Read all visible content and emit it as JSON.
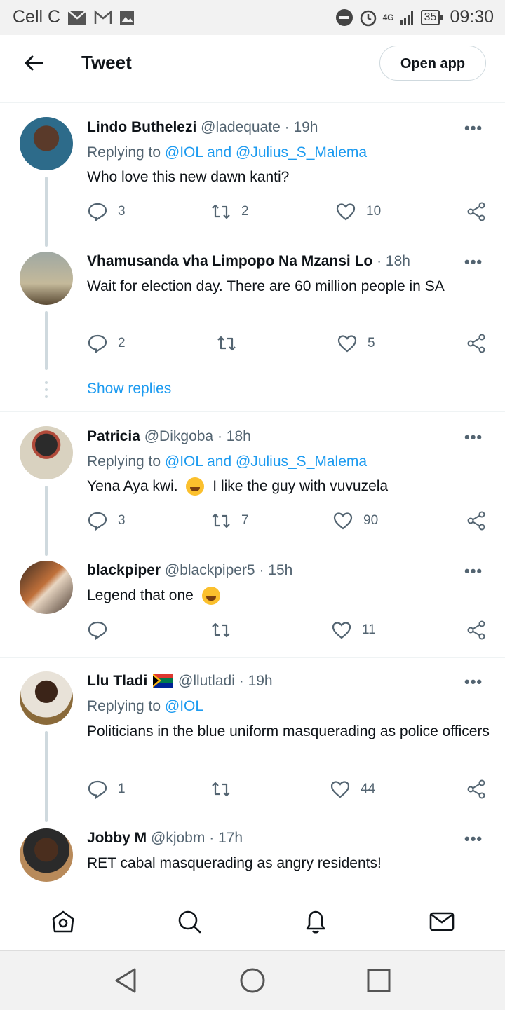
{
  "status_bar": {
    "carrier": "Cell C",
    "network": "4G",
    "battery": "35",
    "time": "09:30"
  },
  "header": {
    "title": "Tweet",
    "open_app_label": "Open app"
  },
  "tweets": [
    {
      "name": "Lindo Buthelezi",
      "handle": "@ladequate",
      "time": "19h",
      "replying_prefix": "Replying to",
      "replying_to": "@IOL and @Julius_S_Malema",
      "text": "Who love this new dawn kanti?",
      "replies": "3",
      "retweets": "2",
      "likes": "10"
    },
    {
      "name": "Vhamusanda vha Limpopo Na Mzansi Lo",
      "handle": "",
      "time": "18h",
      "text": "Wait for election day. There are 60 million people in SA",
      "replies": "2",
      "retweets": "",
      "likes": "5"
    },
    {
      "name": "Patricia",
      "handle": "@Dikgoba",
      "time": "18h",
      "replying_prefix": "Replying to",
      "replying_to": "@IOL and @Julius_S_Malema",
      "text_before_emoji": "Yena Aya kwi.",
      "text_after_emoji": "I like the guy with vuvuzela",
      "replies": "3",
      "retweets": "7",
      "likes": "90"
    },
    {
      "name": "blackpiper",
      "handle": "@blackpiper5",
      "time": "15h",
      "text": "Legend that one",
      "replies": "",
      "retweets": "",
      "likes": "11"
    },
    {
      "name": "Llu Tladi",
      "handle": "@llutladi",
      "time": "19h",
      "replying_prefix": "Replying to",
      "replying_to": "@IOL",
      "text": "Politicians in the blue uniform masquerading as police officers",
      "replies": "1",
      "retweets": "",
      "likes": "44"
    },
    {
      "name": "Jobby M",
      "handle": "@kjobm",
      "time": "17h",
      "text": "RET cabal masquerading as angry residents!"
    }
  ],
  "show_replies_label": "Show replies",
  "more_label": "•••",
  "separator": "·",
  "colors": {
    "link": "#1d9bf0",
    "secondary": "#536471",
    "primary_text": "#0f1419"
  },
  "bottom_nav": [
    "home-icon",
    "search-icon",
    "notifications-icon",
    "messages-icon"
  ],
  "system_nav": [
    "back-icon",
    "home-circle-icon",
    "recents-icon"
  ]
}
